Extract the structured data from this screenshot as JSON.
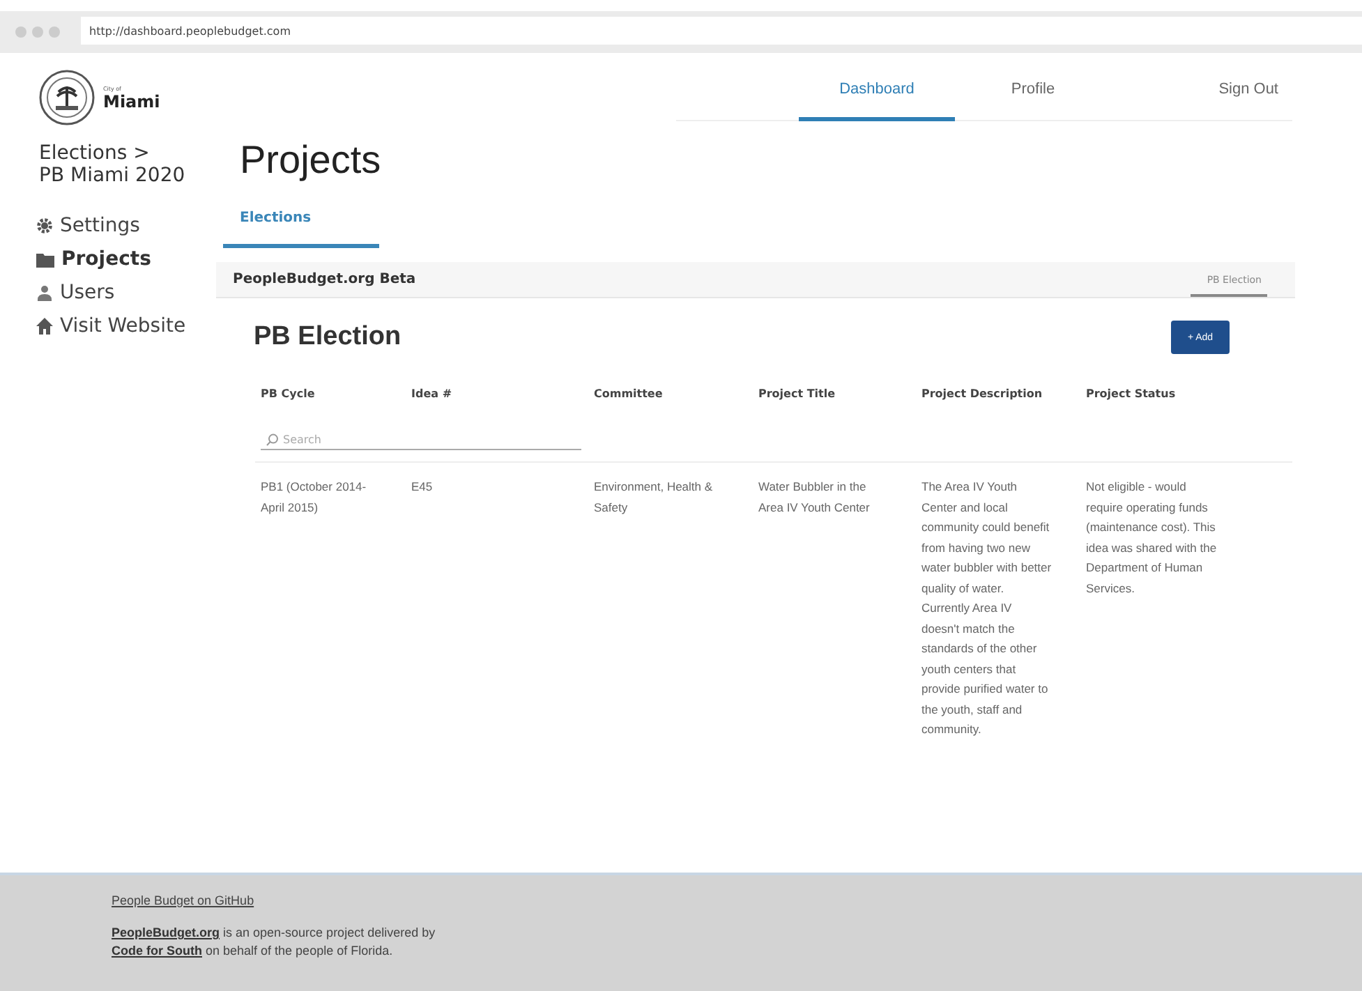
{
  "browser": {
    "url": "http://dashboard.peoplebudget.com"
  },
  "logo": {
    "small": "City of",
    "name": "Miami"
  },
  "breadcrumb": [
    "Elections >",
    "PB Miami 2020"
  ],
  "sidebar": {
    "items": [
      {
        "label": "Settings",
        "kind": "gear",
        "selected": false
      },
      {
        "label": "Projects",
        "kind": "folder",
        "selected": true
      },
      {
        "label": "Users",
        "kind": "user",
        "selected": false
      },
      {
        "label": "Visit Website",
        "kind": "home",
        "selected": false
      }
    ]
  },
  "nav": [
    {
      "label": "Dashboard",
      "selected": true
    },
    {
      "label": "Profile",
      "selected": false
    },
    {
      "label": "Sign Out",
      "selected": false
    }
  ],
  "page_title": "Projects",
  "tabs": [
    {
      "label": "Elections",
      "selected": true
    }
  ],
  "subbar": {
    "title": "PeopleBudget.org Beta",
    "tabs": [
      {
        "label": "PB Election",
        "selected": true
      }
    ]
  },
  "section": {
    "title": "PB Election",
    "add_button": "+ Add"
  },
  "table": {
    "columns": [
      "PB Cycle",
      "Idea #",
      "Committee",
      "Project Title",
      "Project Description",
      "Project Status"
    ],
    "search": {
      "placeholder": "Search"
    },
    "rows": [
      [
        "PB1 (October 2014-April 2015)",
        "E45",
        "Environment, Health & Safety",
        "Water Bubbler in the Area IV Youth Center",
        "The Area IV Youth Center and local community could benefit from having two new water bubbler with better quality of water. Currently Area IV doesn't match the standards of the other youth centers that provide purified water to the youth, staff and community.",
        "Not eligible - would require operating funds (maintenance cost). This idea was shared with the Department of Human Services."
      ]
    ]
  },
  "footer": {
    "github_link": "People Budget on GitHub",
    "about": {
      "link_1": "PeopleBudget.org",
      "text_1": " is an open-source project delivered by ",
      "link_2": "Code for South",
      "text_2": " on behalf of the people of Florida."
    }
  }
}
